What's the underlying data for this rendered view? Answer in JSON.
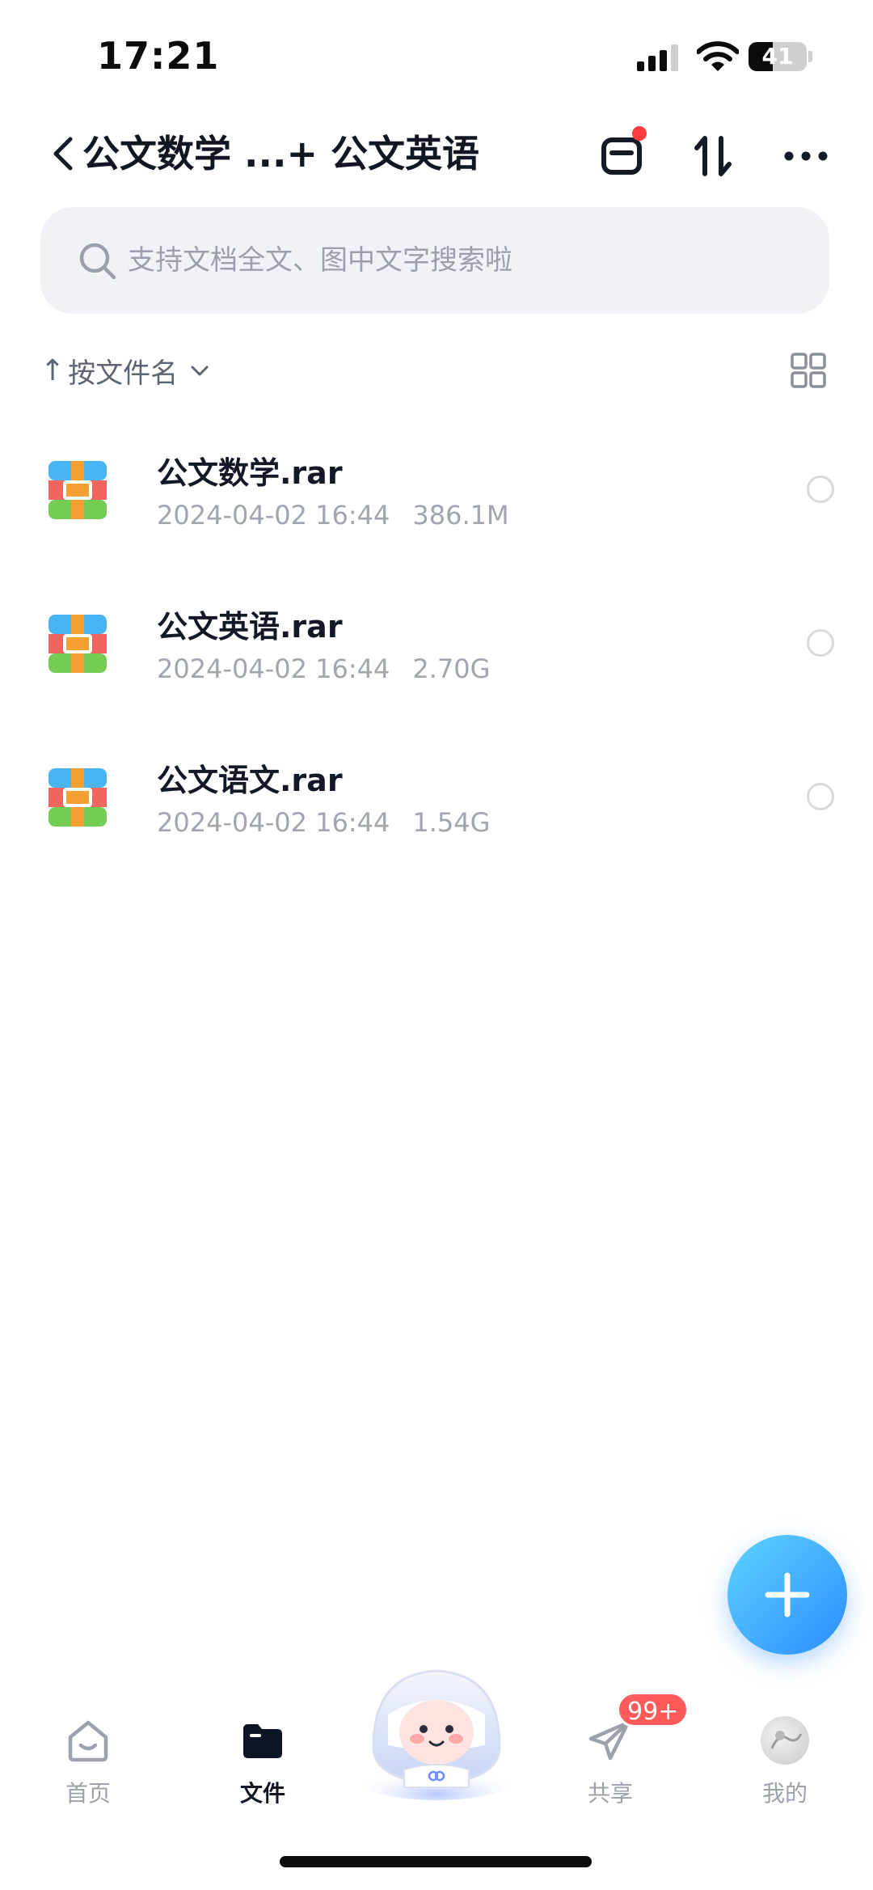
{
  "status_bar": {
    "time": "17:21",
    "battery_level": "41",
    "battery_fraction": 0.41
  },
  "header": {
    "title": "公文数学 ...+ 公文英语",
    "notification_dot_color": "#ff3b3b"
  },
  "search": {
    "placeholder": "支持文档全文、图中文字搜索啦"
  },
  "sort": {
    "label": "按文件名"
  },
  "files": [
    {
      "name": "公文数学.rar",
      "date": "2024-04-02 16:44",
      "size": "386.1M",
      "icon": "rar-archive-icon"
    },
    {
      "name": "公文英语.rar",
      "date": "2024-04-02 16:44",
      "size": "2.70G",
      "icon": "rar-archive-icon"
    },
    {
      "name": "公文语文.rar",
      "date": "2024-04-02 16:44",
      "size": "1.54G",
      "icon": "rar-archive-icon"
    }
  ],
  "tabs": {
    "home": "首页",
    "files": "文件",
    "share": "共享",
    "share_badge": "99+",
    "mine": "我的"
  },
  "colors": {
    "accent": "#2a8dff",
    "badge": "#ff5b5b"
  }
}
